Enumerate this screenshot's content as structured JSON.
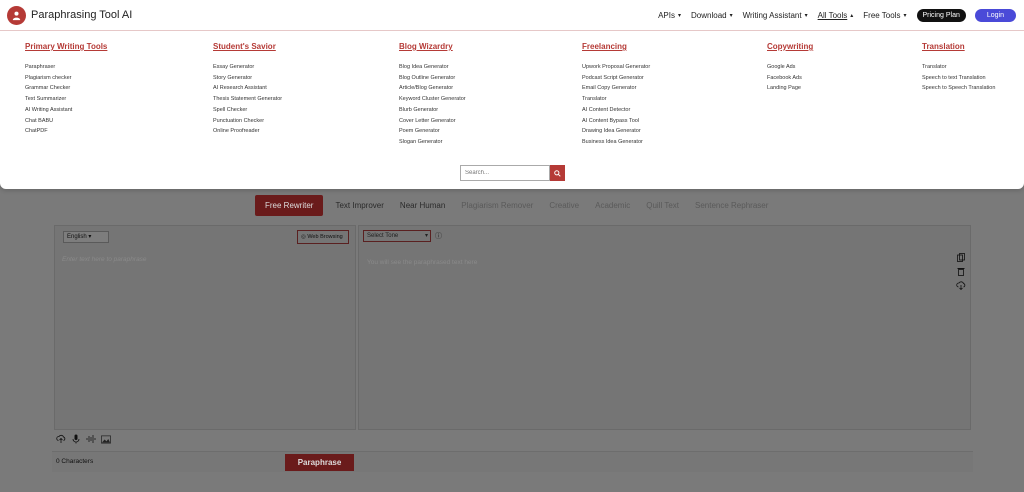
{
  "header": {
    "brand": "Paraphrasing Tool AI",
    "nav": [
      {
        "label": "APIs",
        "caret": "▾"
      },
      {
        "label": "Download",
        "caret": "▾"
      },
      {
        "label": "Writing Assistant",
        "caret": "▾"
      },
      {
        "label": "All Tools",
        "caret": "▴"
      },
      {
        "label": "Free Tools",
        "caret": "▾"
      }
    ],
    "pricing_label": "Pricing Plan",
    "login_label": "Login"
  },
  "mega_menu": {
    "columns": [
      {
        "title": "Primary Writing Tools",
        "links": [
          "Paraphraser",
          "Plagiarism checker",
          "Grammar Checker",
          "Text Summarizer",
          "AI Writing Assistant",
          "Chat BABU",
          "ChatPDF"
        ]
      },
      {
        "title": "Student's Savior",
        "links": [
          "Essay Generator",
          "Story Generator",
          "AI Research Assistant",
          "Thesis Statement Generator",
          "Spell Checker",
          "Punctuation Checker",
          "Online Proofreader"
        ]
      },
      {
        "title": "Blog Wizardry",
        "links": [
          "Blog Idea Generator",
          "Blog Outline Generator",
          "Article/Blog Generator",
          "Keyword Cluster Generator",
          "Blurb Generator",
          "Cover Letter Generator",
          "Poem Generator",
          "Slogan Generator"
        ]
      },
      {
        "title": "Freelancing",
        "links": [
          "Upwork Proposal Generator",
          "Podcast Script Generator",
          "Email Copy Generator",
          "Translator",
          "AI Content Detector",
          "AI Content Bypass Tool",
          "Drawing Idea Generator",
          "Business Idea Generator"
        ]
      },
      {
        "title": "Copywriting",
        "links": [
          "Google Ads",
          "Facebook Ads",
          "Landing Page"
        ]
      },
      {
        "title": "Translation",
        "links": [
          "Translator",
          "Speech to text Translation",
          "Speech to Speech Translation"
        ]
      }
    ],
    "search_placeholder": "Search..."
  },
  "app": {
    "tabs": [
      {
        "label": "Free Rewriter"
      },
      {
        "label": "Text Improver"
      },
      {
        "label": "Near Human"
      },
      {
        "label": "Plagiarism Remover"
      },
      {
        "label": "Creative"
      },
      {
        "label": "Academic"
      },
      {
        "label": "Quill Text"
      },
      {
        "label": "Sentence Rephraser"
      }
    ],
    "language": "English",
    "web_browsing_label": "Web Browsing",
    "input_placeholder": "Enter text here to paraphrase",
    "tone_label": "Select Tone",
    "output_placeholder": "You will see the paraphrased text here",
    "char_count": "0 Characters",
    "paraphrase_label": "Paraphrase"
  },
  "colors": {
    "accent": "#b53a36",
    "login": "#4a4ad8",
    "pricing": "#111111"
  }
}
